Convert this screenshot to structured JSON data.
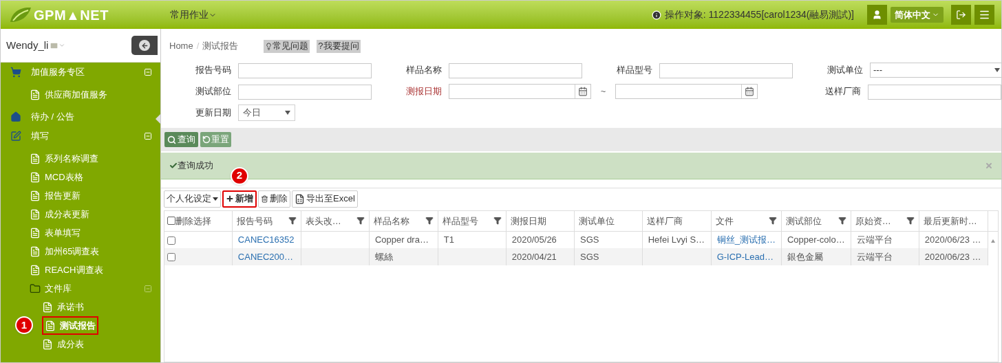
{
  "header": {
    "logo": "GPM▲NET",
    "menu": "常用作业",
    "operator": "操作对象: 1122334455[carol1234(融易測試)]",
    "language": "简体中文"
  },
  "sidebar": {
    "user": "Wendy_li",
    "items": [
      {
        "label": "加值服务专区",
        "kind": "cart",
        "expanded": true,
        "highlighted": false,
        "children": [
          {
            "label": "供应商加值服务",
            "kind": "file",
            "highlighted": false
          }
        ]
      },
      {
        "label": "待办 / 公告",
        "kind": "home",
        "highlighted": false
      },
      {
        "label": "填写",
        "kind": "edit",
        "expanded": true,
        "highlighted": false,
        "children": [
          {
            "label": "系列名称调查",
            "kind": "file",
            "highlighted": false
          },
          {
            "label": "MCD表格",
            "kind": "file",
            "highlighted": false
          },
          {
            "label": "报告更新",
            "kind": "file",
            "highlighted": false
          },
          {
            "label": "成分表更新",
            "kind": "file",
            "highlighted": false
          },
          {
            "label": "表单填写",
            "kind": "file",
            "highlighted": false
          },
          {
            "label": "加州65调查表",
            "kind": "file",
            "highlighted": false
          },
          {
            "label": "REACH调查表",
            "kind": "file",
            "highlighted": false
          },
          {
            "label": "文件库",
            "kind": "folder",
            "expanded": true,
            "highlighted": false,
            "children": [
              {
                "label": "承诺书",
                "kind": "file",
                "highlighted": false
              },
              {
                "label": "测试报告",
                "kind": "file",
                "highlighted": true,
                "step": "1"
              },
              {
                "label": "成分表",
                "kind": "file",
                "highlighted": false
              }
            ]
          }
        ]
      }
    ]
  },
  "breadcrumb": [
    "Home",
    "/",
    "测试报告"
  ],
  "help_buttons": [
    "常见问题",
    "?我要提问"
  ],
  "filters": [
    {
      "label": "报告号码",
      "kind": "text"
    },
    {
      "label": "样品名称",
      "kind": "text"
    },
    {
      "label": "样品型号",
      "kind": "text"
    },
    {
      "label": "测试单位",
      "kind": "select",
      "value": "---"
    },
    {
      "label": "测试部位",
      "kind": "text"
    },
    {
      "label": "测报日期",
      "kind": "daterange",
      "separator": "~"
    },
    {
      "label": "送样厂商",
      "kind": "text"
    },
    {
      "label": "更新日期",
      "kind": "small_select",
      "value": "今日"
    }
  ],
  "search_buttons": [
    "查询",
    "重置"
  ],
  "alert": "查询成功",
  "toolbar": [
    {
      "label": "个人化设定",
      "kind": "dropdown",
      "highlighted": false
    },
    {
      "label": "新增",
      "kind": "add",
      "highlighted": true,
      "step": "2"
    },
    {
      "label": "删除",
      "kind": "delete",
      "highlighted": false
    },
    {
      "label": "导出至Excel",
      "kind": "excel",
      "highlighted": false
    }
  ],
  "table": {
    "select_label": "删除选择",
    "select_all_checked": false,
    "columns": [
      {
        "label": "报告号码",
        "filter": true,
        "link": true
      },
      {
        "label": "表头改…",
        "filter": true,
        "link": false
      },
      {
        "label": "样品名称",
        "filter": true,
        "link": false
      },
      {
        "label": "样品型号",
        "filter": true,
        "link": false
      },
      {
        "label": "测报日期",
        "filter": false,
        "link": false
      },
      {
        "label": "测试单位",
        "filter": false,
        "link": false
      },
      {
        "label": "送样厂商",
        "filter": false,
        "link": false
      },
      {
        "label": "文件",
        "filter": true,
        "link": true
      },
      {
        "label": "测试部位",
        "filter": true,
        "link": false
      },
      {
        "label": "原始资…",
        "filter": true,
        "link": false
      },
      {
        "label": "最后更新时…",
        "filter": false,
        "link": false
      }
    ],
    "rows": [
      {
        "checked": false,
        "cells": [
          "CANEC16352",
          "",
          "Copper dra…",
          "T1",
          "2020/05/26",
          "SGS",
          "Hefei Lvyi S…",
          "铜丝_测试报…",
          "Copper-colo…",
          "云端平台",
          "2020/06/23 …"
        ]
      },
      {
        "checked": false,
        "cells": [
          "CANEC200…",
          "",
          "螺絲",
          "",
          "2020/04/21",
          "SGS",
          "",
          "G-ICP-Lead…",
          "銀色金屬",
          "云端平台",
          "2020/06/23 …"
        ]
      }
    ]
  }
}
